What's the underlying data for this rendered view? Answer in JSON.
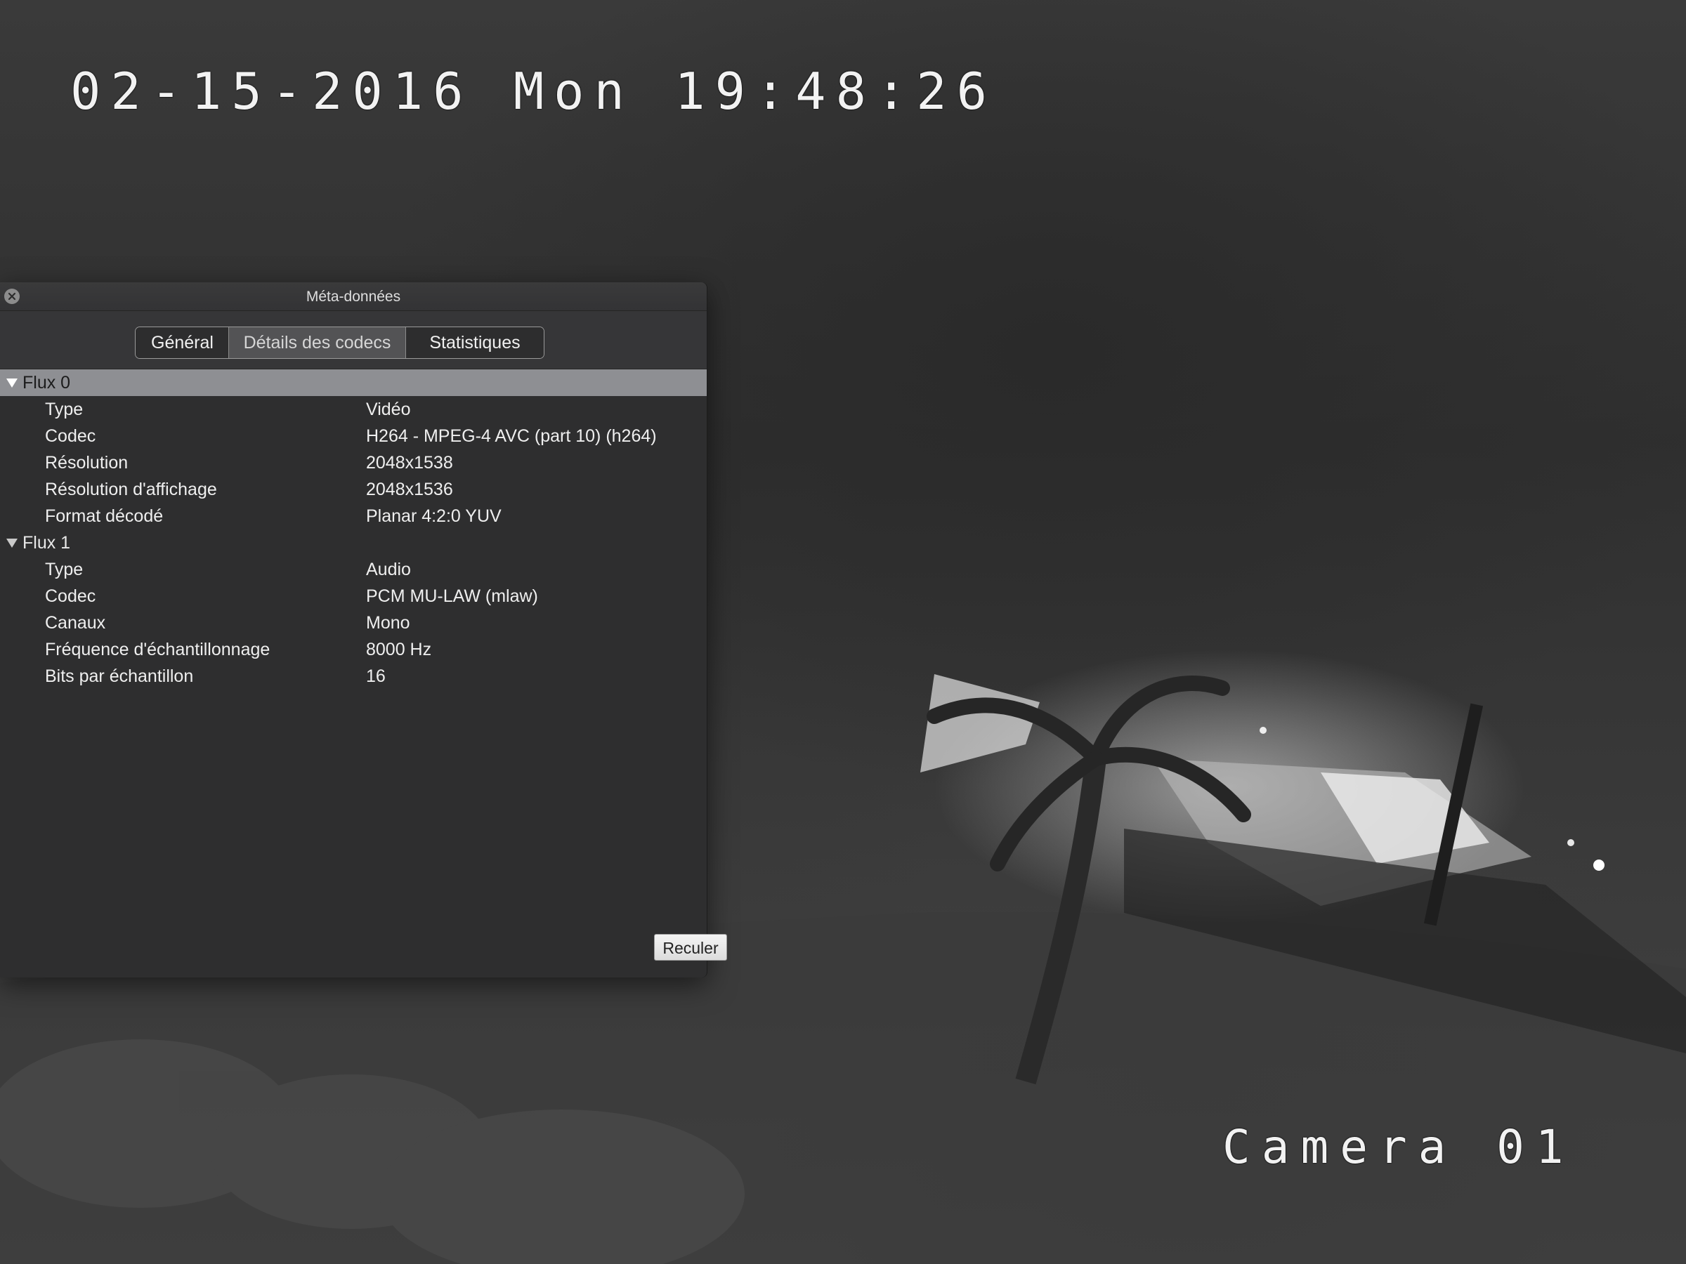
{
  "video": {
    "osd_datetime": "02-15-2016 Mon 19:48:26",
    "osd_camera": "Camera 01"
  },
  "panel": {
    "title": "Méta-données",
    "close_icon": "close-icon",
    "tabs": [
      {
        "label": "Général",
        "selected": false
      },
      {
        "label": "Détails des codecs",
        "selected": true
      },
      {
        "label": "Statistiques",
        "selected": false
      }
    ],
    "streams": [
      {
        "label": "Flux 0",
        "expanded": true,
        "properties": [
          {
            "key": "Type",
            "value": "Vidéo"
          },
          {
            "key": "Codec",
            "value": "H264 - MPEG-4 AVC (part 10) (h264)"
          },
          {
            "key": "Résolution",
            "value": "2048x1538"
          },
          {
            "key": "Résolution d'affichage",
            "value": "2048x1536"
          },
          {
            "key": "Format décodé",
            "value": "Planar 4:2:0 YUV"
          }
        ]
      },
      {
        "label": "Flux 1",
        "expanded": true,
        "properties": [
          {
            "key": "Type",
            "value": "Audio"
          },
          {
            "key": "Codec",
            "value": "PCM MU-LAW (mlaw)"
          },
          {
            "key": "Canaux",
            "value": "Mono"
          },
          {
            "key": "Fréquence d'échantillonnage",
            "value": "8000 Hz"
          },
          {
            "key": "Bits par échantillon",
            "value": "16"
          }
        ]
      }
    ],
    "back_button_label": "Reculer"
  }
}
